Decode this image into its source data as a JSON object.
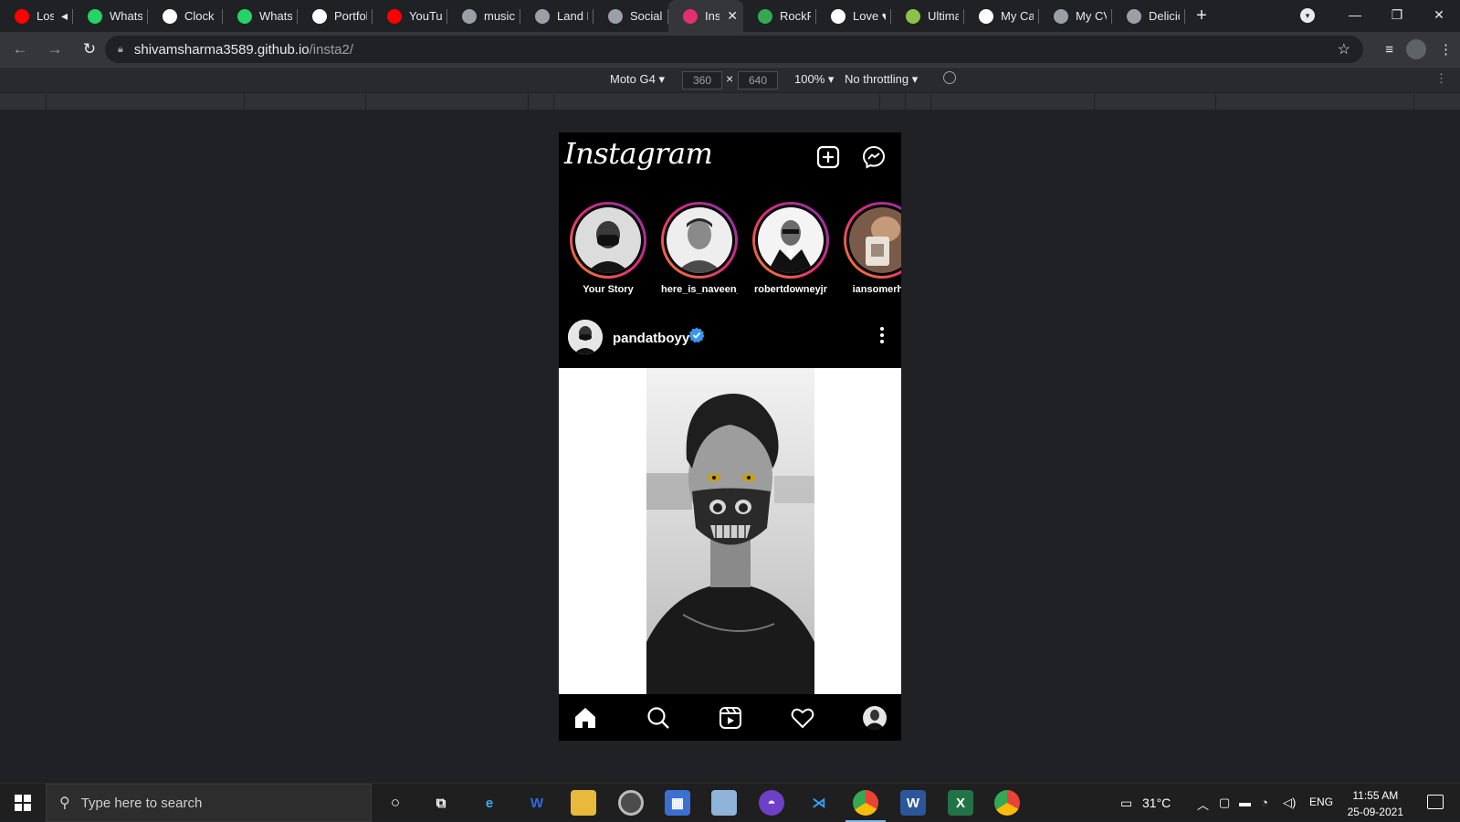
{
  "browser": {
    "tabs": [
      {
        "label": "Lost",
        "favicon": "youtube-icon",
        "color": "#ff0000",
        "muted": true
      },
      {
        "label": "WhatsA",
        "favicon": "whatsapp-icon",
        "color": "#25d366"
      },
      {
        "label": "Clock",
        "favicon": "clock-icon",
        "color": "#ffffff"
      },
      {
        "label": "WhatsA",
        "favicon": "whatsapp-icon",
        "color": "#25d366"
      },
      {
        "label": "Portfoli",
        "favicon": "dollar-icon",
        "color": "#ffffff"
      },
      {
        "label": "YouTub",
        "favicon": "youtube-icon",
        "color": "#ff0000"
      },
      {
        "label": "music l",
        "favicon": "globe-icon",
        "color": "#9aa0a6"
      },
      {
        "label": "Land Re",
        "favicon": "globe-icon",
        "color": "#9aa0a6"
      },
      {
        "label": "SocialM",
        "favicon": "globe-icon",
        "color": "#9aa0a6"
      },
      {
        "label": "Inst",
        "favicon": "instagram-icon",
        "color": "#e1306c",
        "active": true
      },
      {
        "label": "RockPa",
        "favicon": "rockpaper-icon",
        "color": "#34a853"
      },
      {
        "label": "Love ♥",
        "favicon": "chart-icon",
        "color": "#ffffff"
      },
      {
        "label": "Ultimat",
        "favicon": "ultimate-icon",
        "color": "#8bc34a"
      },
      {
        "label": "My Car",
        "favicon": "circle-icon",
        "color": "#ffffff"
      },
      {
        "label": "My CV",
        "favicon": "globe-icon",
        "color": "#9aa0a6"
      },
      {
        "label": "Delicio",
        "favicon": "globe-icon",
        "color": "#9aa0a6"
      }
    ],
    "url_host": "shivamsharma3589.github.io",
    "url_path": "/insta2/"
  },
  "devtools": {
    "device": "Moto G4 ▾",
    "width": "360",
    "height": "640",
    "times": "×",
    "zoom": "100% ▾",
    "throttling": "No throttling ▾"
  },
  "instagram": {
    "logo": "Instagram",
    "stories": [
      {
        "username": "Your Story"
      },
      {
        "username": "here_is_naveen_"
      },
      {
        "username": "robertdowneyjr"
      },
      {
        "username": "iansomerhal"
      }
    ],
    "post": {
      "username": "pandatboyy"
    }
  },
  "taskbar": {
    "search_placeholder": "Type here to search",
    "weather": "31°C",
    "language": "ENG",
    "time": "11:55 AM",
    "date": "25-09-2021"
  },
  "colors": {
    "story_ring_start": "#f58529",
    "story_ring_end": "#8134af",
    "verified_blue": "#3897f0"
  }
}
